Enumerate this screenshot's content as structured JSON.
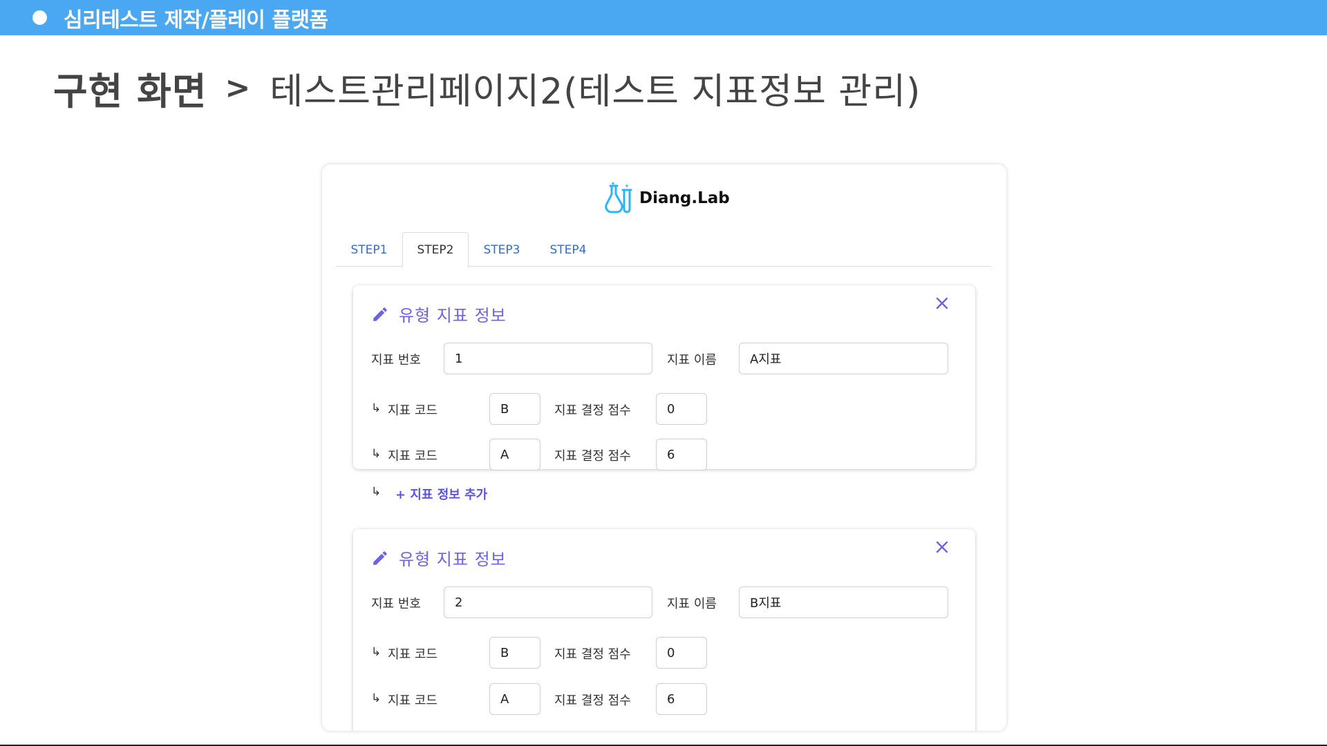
{
  "topbar": {
    "title": "심리테스트 제작/플레이 플랫폼"
  },
  "heading": {
    "main": "구현 화면",
    "arrow": ">",
    "sub": "테스트관리페이지2(테스트 지표정보 관리)"
  },
  "app": {
    "brand": "Diang.Lab",
    "tabs": [
      "STEP1",
      "STEP2",
      "STEP3",
      "STEP4"
    ],
    "active_tab": "STEP2",
    "labels": {
      "card_title": "유형 지표 정보",
      "index_number": "지표 번호",
      "index_name": "지표 이름",
      "index_code": "지표 코드",
      "decision_score": "지표 결정 점수",
      "sub_arrow": "↳",
      "add_index_info": "+ 지표 정보 추가"
    },
    "cards": [
      {
        "number": "1",
        "name": "A지표",
        "codes": [
          {
            "code": "B",
            "score": "0"
          },
          {
            "code": "A",
            "score": "6"
          }
        ]
      },
      {
        "number": "2",
        "name": "B지표",
        "codes": [
          {
            "code": "B",
            "score": "0"
          },
          {
            "code": "A",
            "score": "6"
          }
        ]
      }
    ]
  },
  "colors": {
    "topbar": "#4aa8f2",
    "accent": "#6b63e6",
    "tab_link": "#2a6fd8",
    "logo_flask": "#29b6f6"
  },
  "icons": {
    "edit": "pencil-icon",
    "close": "close-icon",
    "logo": "flask-icon"
  }
}
